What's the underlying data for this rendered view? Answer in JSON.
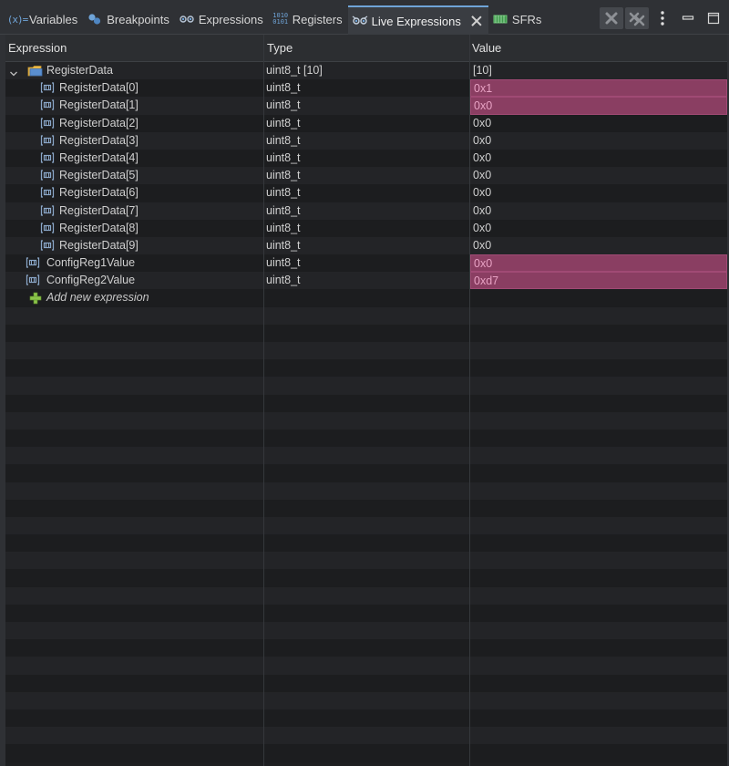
{
  "tabs": [
    {
      "label": "Variables",
      "icon": "variables-icon",
      "active": false
    },
    {
      "label": "Breakpoints",
      "icon": "breakpoints-icon",
      "active": false
    },
    {
      "label": "Expressions",
      "icon": "expressions-icon",
      "active": false
    },
    {
      "label": "Registers",
      "icon": "registers-icon",
      "active": false
    },
    {
      "label": "Live Expressions",
      "icon": "live-expressions-icon",
      "active": true
    },
    {
      "label": "SFRs",
      "icon": "sfrs-icon",
      "active": false
    }
  ],
  "toolbar": {
    "icons": [
      "remove-expression-icon",
      "remove-all-expressions-icon",
      "view-menu-icon",
      "minimize-icon",
      "maximize-icon"
    ]
  },
  "columns": {
    "expression": "Expression",
    "type": "Type",
    "value": "Value"
  },
  "rows": [
    {
      "name": "RegisterData",
      "type": "uint8_t [10]",
      "value": "[10]",
      "level": 0,
      "expandable": true,
      "expanded": true,
      "icon": "array-icon",
      "changed": false
    },
    {
      "name": "RegisterData[0]",
      "type": "uint8_t",
      "value": "0x1",
      "level": 1,
      "icon": "variable-icon",
      "changed": true
    },
    {
      "name": "RegisterData[1]",
      "type": "uint8_t",
      "value": "0x0",
      "level": 1,
      "icon": "variable-icon",
      "changed": true
    },
    {
      "name": "RegisterData[2]",
      "type": "uint8_t",
      "value": "0x0",
      "level": 1,
      "icon": "variable-icon",
      "changed": false
    },
    {
      "name": "RegisterData[3]",
      "type": "uint8_t",
      "value": "0x0",
      "level": 1,
      "icon": "variable-icon",
      "changed": false
    },
    {
      "name": "RegisterData[4]",
      "type": "uint8_t",
      "value": "0x0",
      "level": 1,
      "icon": "variable-icon",
      "changed": false
    },
    {
      "name": "RegisterData[5]",
      "type": "uint8_t",
      "value": "0x0",
      "level": 1,
      "icon": "variable-icon",
      "changed": false
    },
    {
      "name": "RegisterData[6]",
      "type": "uint8_t",
      "value": "0x0",
      "level": 1,
      "icon": "variable-icon",
      "changed": false
    },
    {
      "name": "RegisterData[7]",
      "type": "uint8_t",
      "value": "0x0",
      "level": 1,
      "icon": "variable-icon",
      "changed": false
    },
    {
      "name": "RegisterData[8]",
      "type": "uint8_t",
      "value": "0x0",
      "level": 1,
      "icon": "variable-icon",
      "changed": false
    },
    {
      "name": "RegisterData[9]",
      "type": "uint8_t",
      "value": "0x0",
      "level": 1,
      "icon": "variable-icon",
      "changed": false
    },
    {
      "name": "ConfigReg1Value",
      "type": "uint8_t",
      "value": "0x0",
      "level": 0,
      "icon": "variable-icon",
      "changed": true
    },
    {
      "name": "ConfigReg2Value",
      "type": "uint8_t",
      "value": "0xd7",
      "level": 0,
      "icon": "variable-icon",
      "changed": true
    }
  ],
  "add_row": {
    "label": "Add new expression",
    "icon": "add-icon"
  },
  "empty_rows": 26,
  "colors": {
    "changed_value_bg": "#8a3e62",
    "changed_value_text": "#e8a2c4",
    "active_tab_accent": "#6fa4d8"
  }
}
